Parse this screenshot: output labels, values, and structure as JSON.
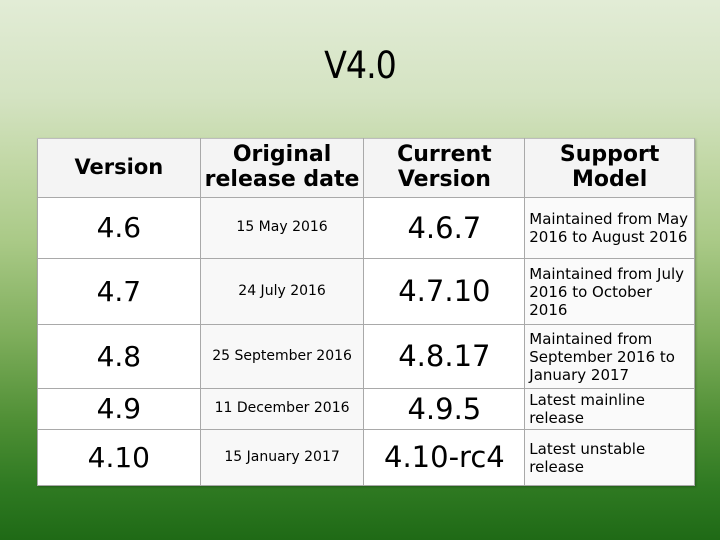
{
  "slide": {
    "title": "V4.0"
  },
  "table": {
    "headers": [
      "Version",
      "Original release date",
      "Current Version",
      "Support Model"
    ],
    "rows": [
      {
        "version": "4.6",
        "release_date": "15 May 2016",
        "current": "4.6.7",
        "support": "Maintained from May 2016 to August 2016"
      },
      {
        "version": "4.7",
        "release_date": "24 July 2016",
        "current": "4.7.10",
        "support": "Maintained from July 2016 to October 2016"
      },
      {
        "version": "4.8",
        "release_date": "25 September 2016",
        "current": "4.8.17",
        "support": "Maintained from September 2016 to January 2017"
      },
      {
        "version": "4.9",
        "release_date": "11 December 2016",
        "current": "4.9.5",
        "support": "Latest mainline release"
      },
      {
        "version": "4.10",
        "release_date": "15 January 2017",
        "current": "4.10-rc4",
        "support": "Latest unstable release"
      }
    ]
  }
}
